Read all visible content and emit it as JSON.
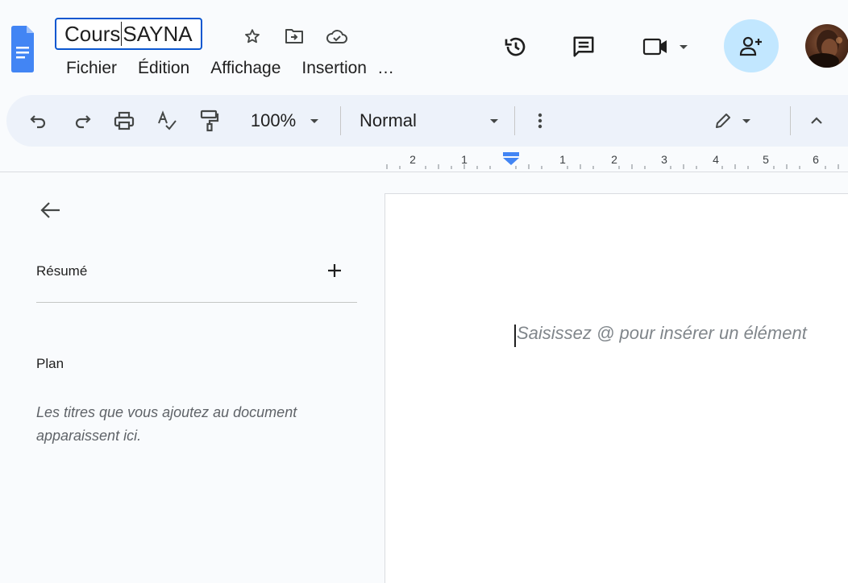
{
  "document": {
    "title_part1": "Cours",
    "title_part2": "SAYNA"
  },
  "menu": {
    "items": [
      "Fichier",
      "Édition",
      "Affichage",
      "Insertion",
      "…"
    ]
  },
  "toolbar": {
    "zoom": "100%",
    "style": "Normal"
  },
  "ruler": {
    "labels": [
      "2",
      "1",
      "1",
      "2",
      "3",
      "4",
      "5",
      "6"
    ]
  },
  "side_panel": {
    "summary_label": "Résumé",
    "plan_label": "Plan",
    "hint": "Les titres que vous ajoutez au document apparaissent ici."
  },
  "page": {
    "placeholder": "Saisissez @ pour insérer un élément"
  },
  "colors": {
    "accent": "#0b57d0",
    "docs_blue": "#4285f4",
    "share_bg": "#c2e7ff",
    "toolbar_bg": "#edf2fa"
  },
  "icons": {
    "header": [
      "docs-logo",
      "star-icon",
      "move-folder-icon",
      "cloud-saved-icon",
      "history-icon",
      "comments-icon",
      "meet-camera-icon",
      "share-person-add-icon"
    ],
    "toolbar": [
      "undo-icon",
      "redo-icon",
      "print-icon",
      "spellcheck-icon",
      "paint-format-icon",
      "more-vert-icon",
      "edit-mode-pencil-icon",
      "collapse-chevron-icon"
    ]
  }
}
